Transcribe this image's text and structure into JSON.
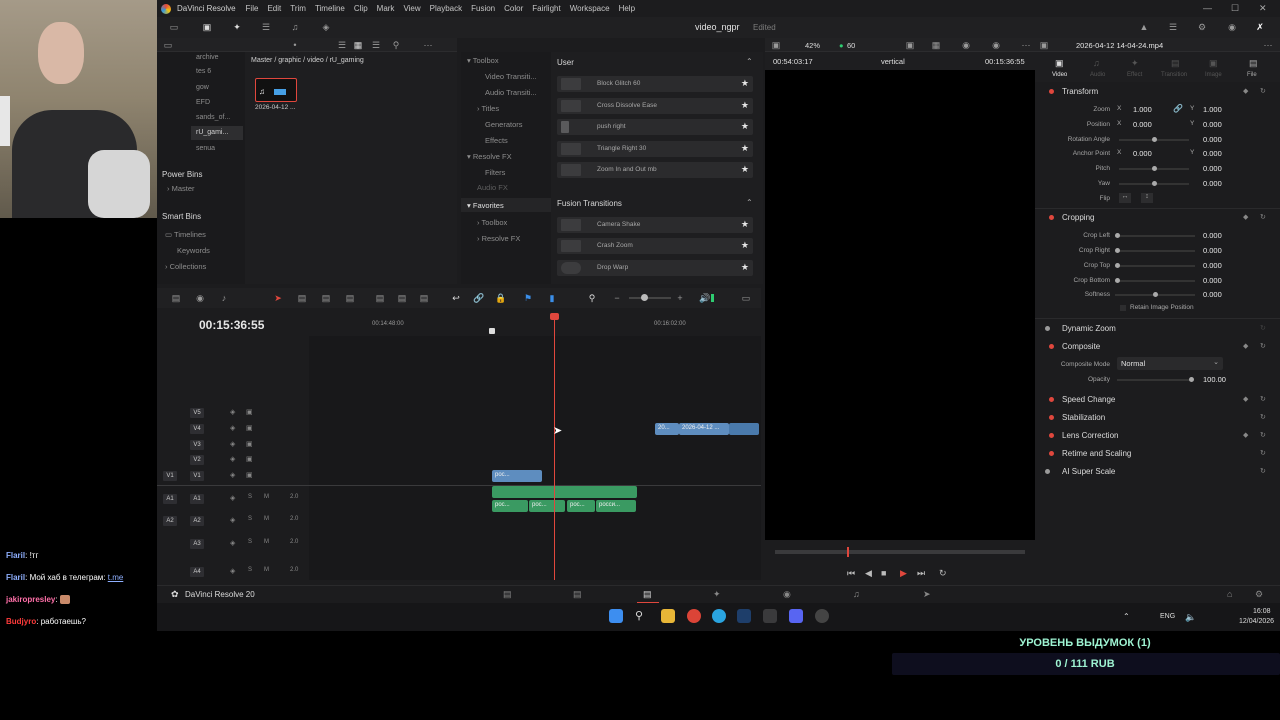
{
  "app": {
    "menu": [
      "DaVinci Resolve",
      "File",
      "Edit",
      "Trim",
      "Timeline",
      "Clip",
      "Mark",
      "View",
      "Playback",
      "Fusion",
      "Color",
      "Fairlight",
      "Workspace",
      "Help"
    ],
    "project_title": "video_ngpr",
    "project_status": "Edited"
  },
  "media_pool": {
    "bins": [
      "archive",
      "tes 6",
      "gow",
      "EFD",
      "sands_of...",
      "rU_gami...",
      "senua"
    ],
    "selected_bin": "rU_gami...",
    "power_bins_title": "Power Bins",
    "power_bins_items": [
      "Master"
    ],
    "smart_bins_title": "Smart Bins",
    "smart_bins_items": [
      "Timelines",
      "Keywords",
      "Collections"
    ],
    "path": "Master / graphic / video / rU_gaming",
    "clip_name": "2026-04-12 ..."
  },
  "effects": {
    "tree": [
      "Toolbox",
      "Video Transiti...",
      "Audio Transiti...",
      "Titles",
      "Generators",
      "Effects",
      "Resolve FX",
      "Filters",
      "Audio FX"
    ],
    "favorites_title": "Favorites",
    "favorites_tree": [
      "Toolbox",
      "Resolve FX"
    ],
    "user_title": "User",
    "user_items": [
      "Block Glitch 60",
      "Cross Dissolve Ease",
      "push right",
      "Triangle Right 30",
      "Zoom In and Out mb"
    ],
    "fusion_title": "Fusion Transitions",
    "fusion_items": [
      "Camera Shake",
      "Crash Zoom",
      "Drop Warp"
    ]
  },
  "viewer": {
    "zoom": "42%",
    "fps": "60",
    "timecode_left": "00:54:03:17",
    "timeline_name": "vertical",
    "timecode_right": "00:15:36:55"
  },
  "timeline": {
    "timecode": "00:15:36:55",
    "ruler": [
      "00:14:48:00",
      "00:16:02:00"
    ],
    "video_tracks": [
      "V5",
      "V4",
      "V3",
      "V2",
      "V1"
    ],
    "audio_tracks": [
      {
        "name": "A1",
        "level": "2.0"
      },
      {
        "name": "A2",
        "level": "2.0"
      },
      {
        "name": "A3",
        "level": "2.0"
      },
      {
        "name": "A4",
        "level": "2.0"
      }
    ],
    "v1_label": "V1",
    "a1_label": "A1",
    "a2_label": "A2",
    "clips_v4": [
      "20...",
      "2026-04-12 ..."
    ],
    "clips_v1": [
      "рос..."
    ],
    "clips_a1": [
      "рос...",
      "рос...",
      "рос...",
      "росси..."
    ]
  },
  "inspector": {
    "file_name": "2026-04-12 14-04-24.mp4",
    "tabs": [
      "Video",
      "Audio",
      "Effect",
      "Transition",
      "Image",
      "File"
    ],
    "transform_title": "Transform",
    "transform_rows": [
      {
        "label": "Zoom",
        "x_label": "X",
        "x": "1.000",
        "y_label": "Y",
        "y": "1.000"
      },
      {
        "label": "Position",
        "x_label": "X",
        "x": "0.000",
        "y_label": "Y",
        "y": "0.000"
      },
      {
        "label": "Rotation Angle",
        "value": "0.000"
      },
      {
        "label": "Anchor Point",
        "x_label": "X",
        "x": "0.000",
        "y_label": "Y",
        "y": "0.000"
      },
      {
        "label": "Pitch",
        "value": "0.000"
      },
      {
        "label": "Yaw",
        "value": "0.000"
      },
      {
        "label": "Flip"
      }
    ],
    "cropping_title": "Cropping",
    "cropping_rows": [
      {
        "label": "Crop Left",
        "value": "0.000"
      },
      {
        "label": "Crop Right",
        "value": "0.000"
      },
      {
        "label": "Crop Top",
        "value": "0.000"
      },
      {
        "label": "Crop Bottom",
        "value": "0.000"
      },
      {
        "label": "Softness",
        "value": "0.000"
      }
    ],
    "retain": "Retain Image Position",
    "dynamic_zoom": "Dynamic Zoom",
    "composite_title": "Composite",
    "composite_mode_label": "Composite Mode",
    "composite_mode_value": "Normal",
    "opacity_label": "Opacity",
    "opacity_value": "100.00",
    "sections": [
      "Speed Change",
      "Stabilization",
      "Lens Correction",
      "Retime and Scaling",
      "AI Super Scale"
    ]
  },
  "footer": {
    "app_name": "DaVinci Resolve 20"
  },
  "taskbar": {
    "lang": "ENG",
    "time": "16:08",
    "date": "12/04/2026"
  },
  "chat": [
    {
      "name": "Flaril",
      "text": "!тг",
      "color": "#8fb0ff"
    },
    {
      "name": "Flaril",
      "text": "Мой хаб в телеграм: ",
      "link": "t.me",
      "color": "#8fb0ff"
    },
    {
      "name": "jakiropresley",
      "text": "",
      "color": "#ff6fa8"
    },
    {
      "name": "Budjyro",
      "text": "работаешь?",
      "color": "#ff3b3b"
    }
  ],
  "donation": {
    "title": "УРОВЕНЬ ВЫДУМОК (1)",
    "progress": "0 / 111 RUB",
    "progress_fraction": 0
  }
}
